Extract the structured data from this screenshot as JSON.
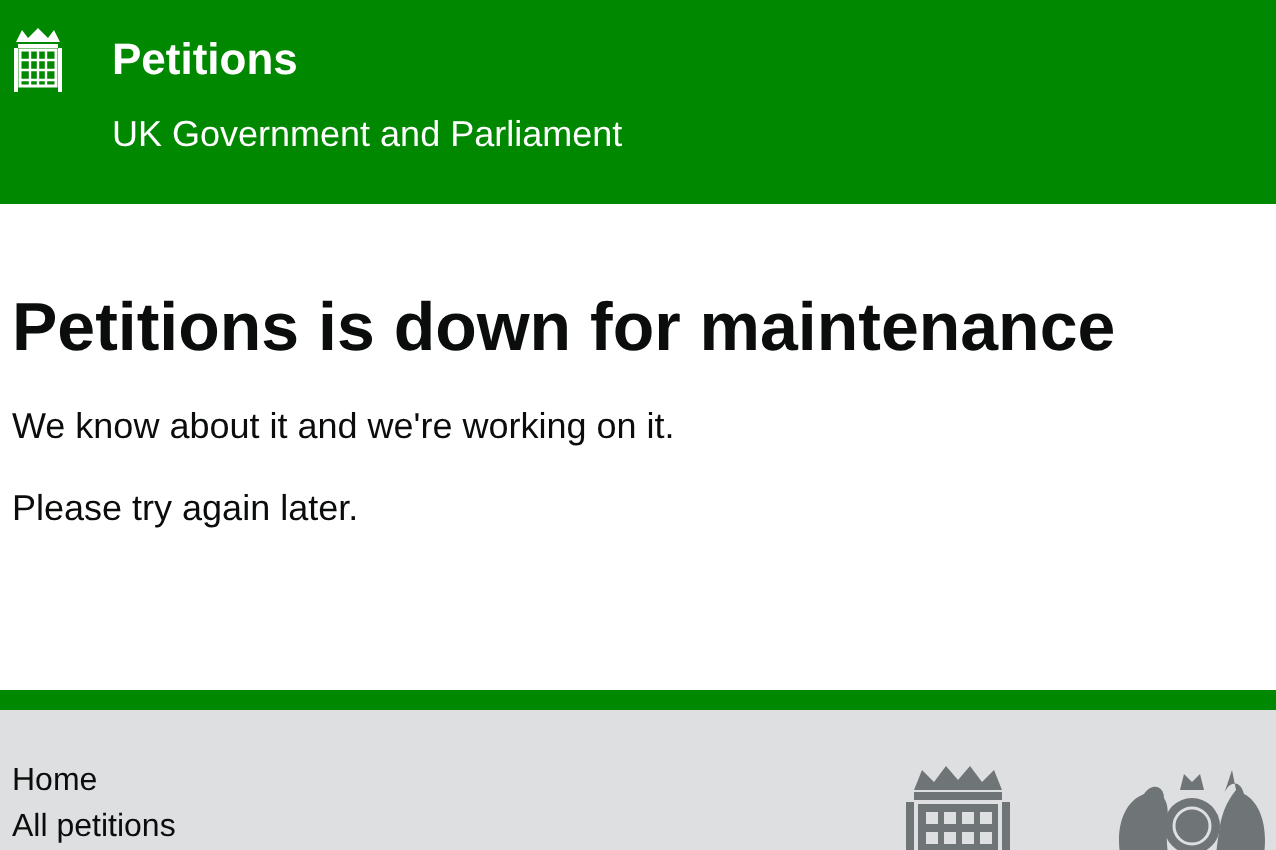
{
  "header": {
    "title": "Petitions",
    "subtitle": "UK Government and Parliament"
  },
  "main": {
    "heading": "Petitions is down for maintenance",
    "paragraphs": [
      "We know about it and we're working on it.",
      "Please try again later."
    ]
  },
  "footer": {
    "links": [
      "Home",
      "All petitions"
    ]
  }
}
